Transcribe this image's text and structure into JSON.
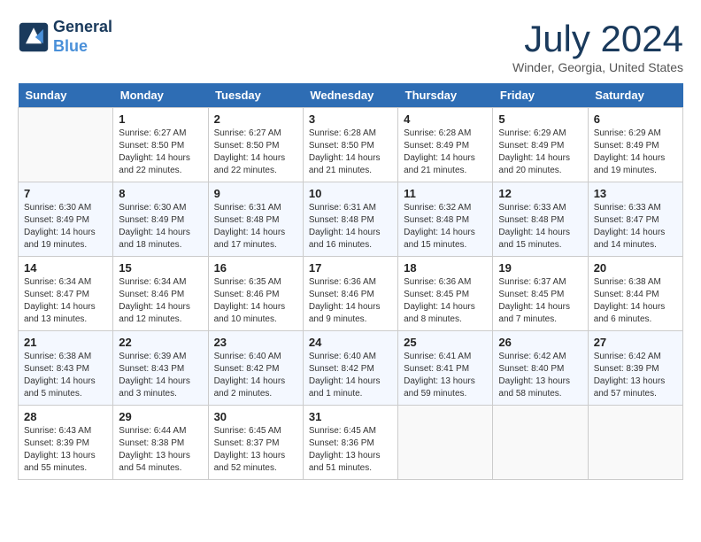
{
  "header": {
    "logo_line1": "General",
    "logo_line2": "Blue",
    "title": "July 2024",
    "location": "Winder, Georgia, United States"
  },
  "days_of_week": [
    "Sunday",
    "Monday",
    "Tuesday",
    "Wednesday",
    "Thursday",
    "Friday",
    "Saturday"
  ],
  "weeks": [
    [
      {
        "day": "",
        "info": ""
      },
      {
        "day": "1",
        "info": "Sunrise: 6:27 AM\nSunset: 8:50 PM\nDaylight: 14 hours\nand 22 minutes."
      },
      {
        "day": "2",
        "info": "Sunrise: 6:27 AM\nSunset: 8:50 PM\nDaylight: 14 hours\nand 22 minutes."
      },
      {
        "day": "3",
        "info": "Sunrise: 6:28 AM\nSunset: 8:50 PM\nDaylight: 14 hours\nand 21 minutes."
      },
      {
        "day": "4",
        "info": "Sunrise: 6:28 AM\nSunset: 8:49 PM\nDaylight: 14 hours\nand 21 minutes."
      },
      {
        "day": "5",
        "info": "Sunrise: 6:29 AM\nSunset: 8:49 PM\nDaylight: 14 hours\nand 20 minutes."
      },
      {
        "day": "6",
        "info": "Sunrise: 6:29 AM\nSunset: 8:49 PM\nDaylight: 14 hours\nand 19 minutes."
      }
    ],
    [
      {
        "day": "7",
        "info": "Sunrise: 6:30 AM\nSunset: 8:49 PM\nDaylight: 14 hours\nand 19 minutes."
      },
      {
        "day": "8",
        "info": "Sunrise: 6:30 AM\nSunset: 8:49 PM\nDaylight: 14 hours\nand 18 minutes."
      },
      {
        "day": "9",
        "info": "Sunrise: 6:31 AM\nSunset: 8:48 PM\nDaylight: 14 hours\nand 17 minutes."
      },
      {
        "day": "10",
        "info": "Sunrise: 6:31 AM\nSunset: 8:48 PM\nDaylight: 14 hours\nand 16 minutes."
      },
      {
        "day": "11",
        "info": "Sunrise: 6:32 AM\nSunset: 8:48 PM\nDaylight: 14 hours\nand 15 minutes."
      },
      {
        "day": "12",
        "info": "Sunrise: 6:33 AM\nSunset: 8:48 PM\nDaylight: 14 hours\nand 15 minutes."
      },
      {
        "day": "13",
        "info": "Sunrise: 6:33 AM\nSunset: 8:47 PM\nDaylight: 14 hours\nand 14 minutes."
      }
    ],
    [
      {
        "day": "14",
        "info": "Sunrise: 6:34 AM\nSunset: 8:47 PM\nDaylight: 14 hours\nand 13 minutes."
      },
      {
        "day": "15",
        "info": "Sunrise: 6:34 AM\nSunset: 8:46 PM\nDaylight: 14 hours\nand 12 minutes."
      },
      {
        "day": "16",
        "info": "Sunrise: 6:35 AM\nSunset: 8:46 PM\nDaylight: 14 hours\nand 10 minutes."
      },
      {
        "day": "17",
        "info": "Sunrise: 6:36 AM\nSunset: 8:46 PM\nDaylight: 14 hours\nand 9 minutes."
      },
      {
        "day": "18",
        "info": "Sunrise: 6:36 AM\nSunset: 8:45 PM\nDaylight: 14 hours\nand 8 minutes."
      },
      {
        "day": "19",
        "info": "Sunrise: 6:37 AM\nSunset: 8:45 PM\nDaylight: 14 hours\nand 7 minutes."
      },
      {
        "day": "20",
        "info": "Sunrise: 6:38 AM\nSunset: 8:44 PM\nDaylight: 14 hours\nand 6 minutes."
      }
    ],
    [
      {
        "day": "21",
        "info": "Sunrise: 6:38 AM\nSunset: 8:43 PM\nDaylight: 14 hours\nand 5 minutes."
      },
      {
        "day": "22",
        "info": "Sunrise: 6:39 AM\nSunset: 8:43 PM\nDaylight: 14 hours\nand 3 minutes."
      },
      {
        "day": "23",
        "info": "Sunrise: 6:40 AM\nSunset: 8:42 PM\nDaylight: 14 hours\nand 2 minutes."
      },
      {
        "day": "24",
        "info": "Sunrise: 6:40 AM\nSunset: 8:42 PM\nDaylight: 14 hours\nand 1 minute."
      },
      {
        "day": "25",
        "info": "Sunrise: 6:41 AM\nSunset: 8:41 PM\nDaylight: 13 hours\nand 59 minutes."
      },
      {
        "day": "26",
        "info": "Sunrise: 6:42 AM\nSunset: 8:40 PM\nDaylight: 13 hours\nand 58 minutes."
      },
      {
        "day": "27",
        "info": "Sunrise: 6:42 AM\nSunset: 8:39 PM\nDaylight: 13 hours\nand 57 minutes."
      }
    ],
    [
      {
        "day": "28",
        "info": "Sunrise: 6:43 AM\nSunset: 8:39 PM\nDaylight: 13 hours\nand 55 minutes."
      },
      {
        "day": "29",
        "info": "Sunrise: 6:44 AM\nSunset: 8:38 PM\nDaylight: 13 hours\nand 54 minutes."
      },
      {
        "day": "30",
        "info": "Sunrise: 6:45 AM\nSunset: 8:37 PM\nDaylight: 13 hours\nand 52 minutes."
      },
      {
        "day": "31",
        "info": "Sunrise: 6:45 AM\nSunset: 8:36 PM\nDaylight: 13 hours\nand 51 minutes."
      },
      {
        "day": "",
        "info": ""
      },
      {
        "day": "",
        "info": ""
      },
      {
        "day": "",
        "info": ""
      }
    ]
  ]
}
